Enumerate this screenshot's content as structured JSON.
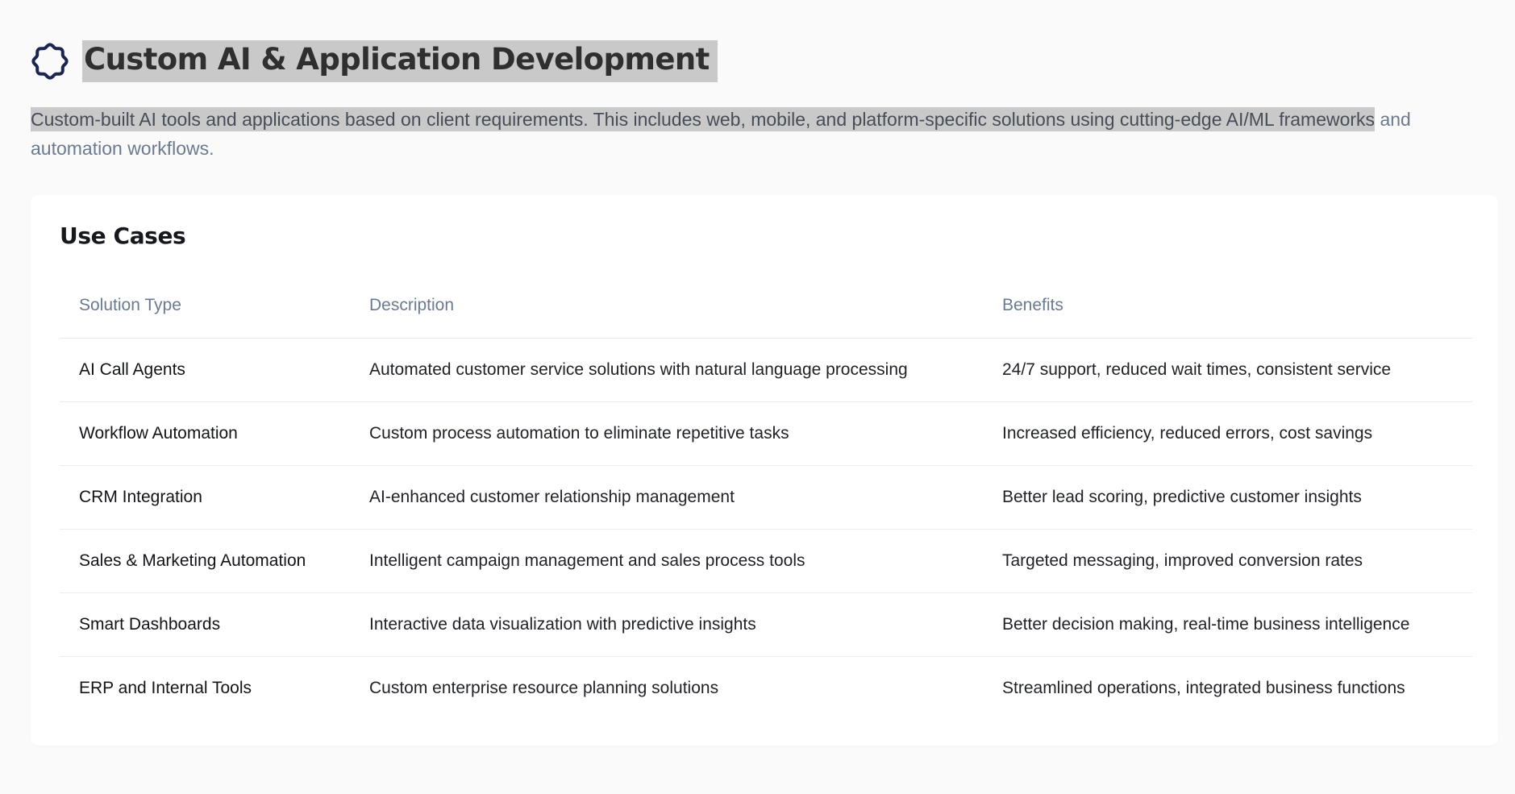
{
  "section": {
    "icon": "scalloped-circle-icon",
    "title": "Custom AI & Application Development",
    "intro_highlighted": "Custom-built AI tools and applications based on client requirements. This includes web, mobile, and platform-specific solutions using cutting-edge AI/ML frameworks",
    "intro_rest": " and automation workflows."
  },
  "use_cases": {
    "title": "Use Cases",
    "columns": [
      "Solution Type",
      "Description",
      "Benefits"
    ],
    "rows": [
      {
        "type": "AI Call Agents",
        "description": "Automated customer service solutions with natural language processing",
        "benefits": "24/7 support, reduced wait times, consistent service"
      },
      {
        "type": "Workflow Automation",
        "description": "Custom process automation to eliminate repetitive tasks",
        "benefits": "Increased efficiency, reduced errors, cost savings"
      },
      {
        "type": "CRM Integration",
        "description": "AI-enhanced customer relationship management",
        "benefits": "Better lead scoring, predictive customer insights"
      },
      {
        "type": "Sales & Marketing Automation",
        "description": "Intelligent campaign management and sales process tools",
        "benefits": "Targeted messaging, improved conversion rates"
      },
      {
        "type": "Smart Dashboards",
        "description": "Interactive data visualization with predictive insights",
        "benefits": "Better decision making, real-time business intelligence"
      },
      {
        "type": "ERP and Internal Tools",
        "description": "Custom enterprise resource planning solutions",
        "benefits": "Streamlined operations, integrated business functions"
      }
    ]
  },
  "colors": {
    "icon_stroke": "#1a2550",
    "highlight": "#c9c9c9",
    "muted_text": "#6b7a8e"
  }
}
